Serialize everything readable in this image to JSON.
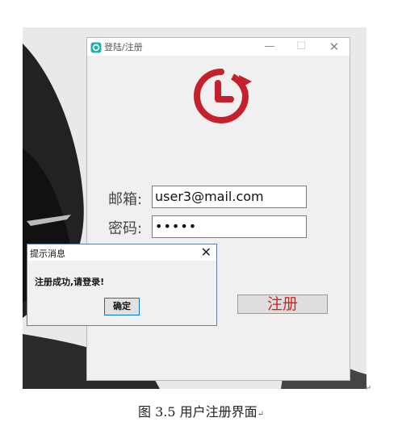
{
  "window": {
    "title": "登陆/注册"
  },
  "form": {
    "email_label": "邮箱:",
    "email_value": "user3@mail.com",
    "password_label": "密码:",
    "password_value": "•••••",
    "register_label": "注册"
  },
  "dialog": {
    "title": "提示消息",
    "message": "注册成功,请登录!",
    "ok_label": "确定"
  },
  "caption": {
    "text": "图 3.5 用户注册界面"
  },
  "colors": {
    "accent": "#c4212c",
    "register_text": "#e02020"
  },
  "icons": [
    "app-icon",
    "clock-refresh-logo-icon",
    "minimize-icon",
    "maximize-icon",
    "close-icon"
  ]
}
